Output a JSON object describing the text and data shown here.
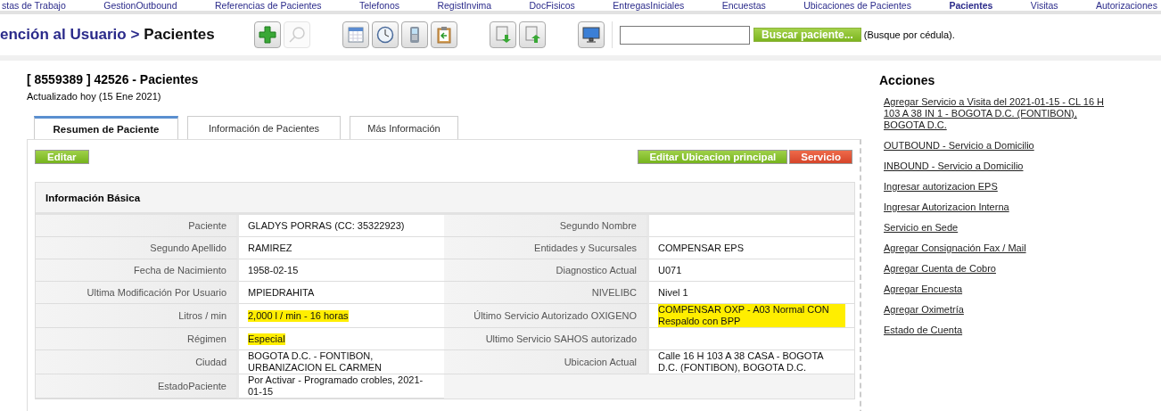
{
  "nav": [
    {
      "label": "stas de Trabajo",
      "selected": false
    },
    {
      "label": "GestionOutbound",
      "selected": false
    },
    {
      "label": "Referencias de Pacientes",
      "selected": false
    },
    {
      "label": "Telefonos",
      "selected": false
    },
    {
      "label": "RegistInvima",
      "selected": false
    },
    {
      "label": "DocFisicos",
      "selected": false
    },
    {
      "label": "EntregasIniciales",
      "selected": false
    },
    {
      "label": "Encuestas",
      "selected": false
    },
    {
      "label": "Ubicaciones de Pacientes",
      "selected": false
    },
    {
      "label": "Pacientes",
      "selected": true
    },
    {
      "label": "Visitas",
      "selected": false
    },
    {
      "label": "Autorizaciones",
      "selected": false
    }
  ],
  "breadcrumb": {
    "parent": "ención al Usuario >",
    "current": "Pacientes"
  },
  "toolbar": [
    [
      {
        "kind": "add",
        "disabled": false
      },
      {
        "kind": "search",
        "disabled": true
      }
    ],
    [
      {
        "kind": "calendar",
        "disabled": false
      },
      {
        "kind": "clock",
        "disabled": false
      },
      {
        "kind": "phone",
        "disabled": false
      },
      {
        "kind": "clipboard",
        "disabled": false
      }
    ],
    [
      {
        "kind": "download",
        "disabled": false
      },
      {
        "kind": "upload",
        "disabled": false
      }
    ],
    [
      {
        "kind": "monitor",
        "disabled": false
      }
    ]
  ],
  "search": {
    "button": "Buscar paciente...",
    "hint": "(Busque por cédula)."
  },
  "record": {
    "title": "[ 8559389 ] 42526 - Pacientes",
    "updated": "Actualizado hoy (15 Ene 2021)"
  },
  "tabs": [
    {
      "label": "Resumen de Paciente",
      "selected": true
    },
    {
      "label": "Información de Pacientes",
      "selected": false
    },
    {
      "label": "Más Información",
      "selected": false
    }
  ],
  "buttons": [
    {
      "label": "Editar",
      "kind": "green"
    },
    {
      "label": "Editar Ubicacion principal",
      "kind": "green"
    },
    {
      "label": "Servicio",
      "kind": "red"
    }
  ],
  "section": {
    "title": "Información Básica",
    "rows": [
      [
        {
          "label": "Paciente",
          "value": "GLADYS PORRAS (CC: 35322923)",
          "highlighted": false
        },
        {
          "label": "Segundo Nombre",
          "highlighted": false
        }
      ],
      [
        {
          "label": "Segundo Apellido",
          "value": "RAMIREZ",
          "highlighted": false
        },
        {
          "label": "Entidades y Sucursales",
          "value": "COMPENSAR EPS",
          "highlighted": false
        }
      ],
      [
        {
          "label": "Fecha de Nacimiento",
          "value": "1958-02-15",
          "highlighted": false
        },
        {
          "label": "Diagnostico Actual",
          "value": "U071",
          "highlighted": false
        }
      ],
      [
        {
          "label": "Ultima Modificación Por Usuario",
          "value": "MPIEDRAHITA",
          "highlighted": false
        },
        {
          "label": "NIVELIBC",
          "value": "Nivel 1",
          "highlighted": false
        }
      ],
      [
        {
          "label": "Litros / min",
          "value": "2,000 l / min - 16 horas",
          "highlighted": true
        },
        {
          "label": "Último Servicio Autorizado OXIGENO",
          "value": "COMPENSAR OXP - A03 Normal CON Respaldo con BPP",
          "highlighted": true
        }
      ],
      [
        {
          "label": "Régimen",
          "value": "Especial",
          "highlighted": true
        },
        {
          "label": "Ultimo Servicio SAHOS autorizado",
          "highlighted": false
        }
      ],
      [
        {
          "label": "Ciudad",
          "value": "BOGOTA D.C. - FONTIBON, URBANIZACION EL CARMEN",
          "highlighted": false
        },
        {
          "label": "Ubicacion Actual",
          "value": "Calle 16 H 103 A 38 CASA - BOGOTA D.C. (FONTIBON), BOGOTA D.C.",
          "highlighted": false
        }
      ],
      [
        {
          "label": "EstadoPaciente",
          "value": "Por Activar - Programado crobles, 2021-01-15",
          "highlighted": false
        }
      ]
    ]
  },
  "actions": {
    "title": "Acciones",
    "links": [
      "Agregar Servicio a Visita del 2021-01-15 - CL 16 H 103 A 38 IN 1 - BOGOTA D.C. (FONTIBON), BOGOTA D.C.",
      "OUTBOUND - Servicio a Domicilio",
      "INBOUND - Servicio a Domicilio",
      "Ingresar autorizacion EPS",
      "Ingresar Autorizacion Interna",
      "Servicio en Sede",
      "Agregar Consignación Fax / Mail",
      "Agregar Cuenta de Cobro",
      "Agregar Encuesta",
      "Agregar Oximetría",
      "Estado de Cuenta"
    ]
  }
}
